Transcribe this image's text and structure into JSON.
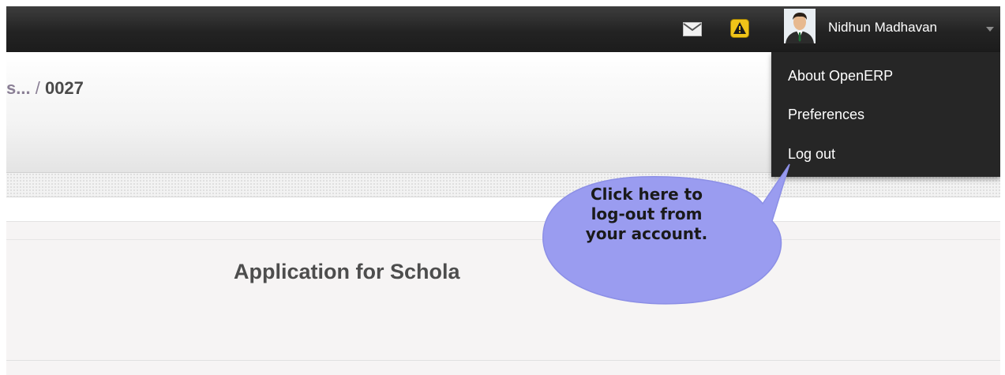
{
  "topbar": {
    "icons": [
      "envelope-icon",
      "alert-icon",
      "avatar",
      "caret-down-icon"
    ],
    "user_name": "Nidhun Madhavan",
    "alert_color": "#f0c419"
  },
  "breadcrumb": {
    "previous": "s...",
    "separator": "/",
    "current": "0027"
  },
  "user_menu": {
    "items": [
      {
        "label": "About OpenERP"
      },
      {
        "label": "Preferences"
      },
      {
        "label": "Log out"
      }
    ]
  },
  "form": {
    "title": "Application for Schola"
  },
  "callout": {
    "text_line1": "Click here to",
    "text_line2": "log-out from",
    "text_line3": "your account.",
    "fill_color": "#9a9cf0"
  }
}
